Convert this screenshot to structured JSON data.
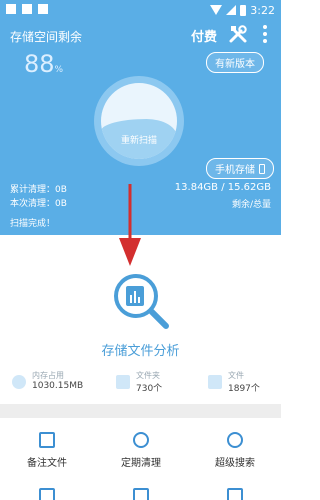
{
  "status_bar": {
    "time": "3:22"
  },
  "header": {
    "title": "存储空间剩余",
    "pay_label": "付费",
    "percent_value": "88",
    "percent_unit": "%",
    "new_version_label": "有新版本",
    "rescan_label": "重新扫描",
    "phone_storage_label": "手机存储",
    "cumulative_clean": "累计清理：0B",
    "this_clean": "本次清理：0B",
    "storage_usage": "13.84GB / 15.62GB",
    "remaining_total": "剩余/总量",
    "scan_complete": "扫描完成！"
  },
  "analysis": {
    "label": "存储文件分析"
  },
  "stats": [
    {
      "label": "内存占用",
      "value": "1030.15MB"
    },
    {
      "label": "文件夹",
      "value": "730个"
    },
    {
      "label": "文件",
      "value": "1897个"
    }
  ],
  "grid": [
    {
      "label": "备注文件"
    },
    {
      "label": "定期清理"
    },
    {
      "label": "超级搜索"
    }
  ],
  "colors": {
    "primary": "#5aaee6",
    "accent": "#3c8fd2",
    "arrow": "#d32f2f"
  }
}
